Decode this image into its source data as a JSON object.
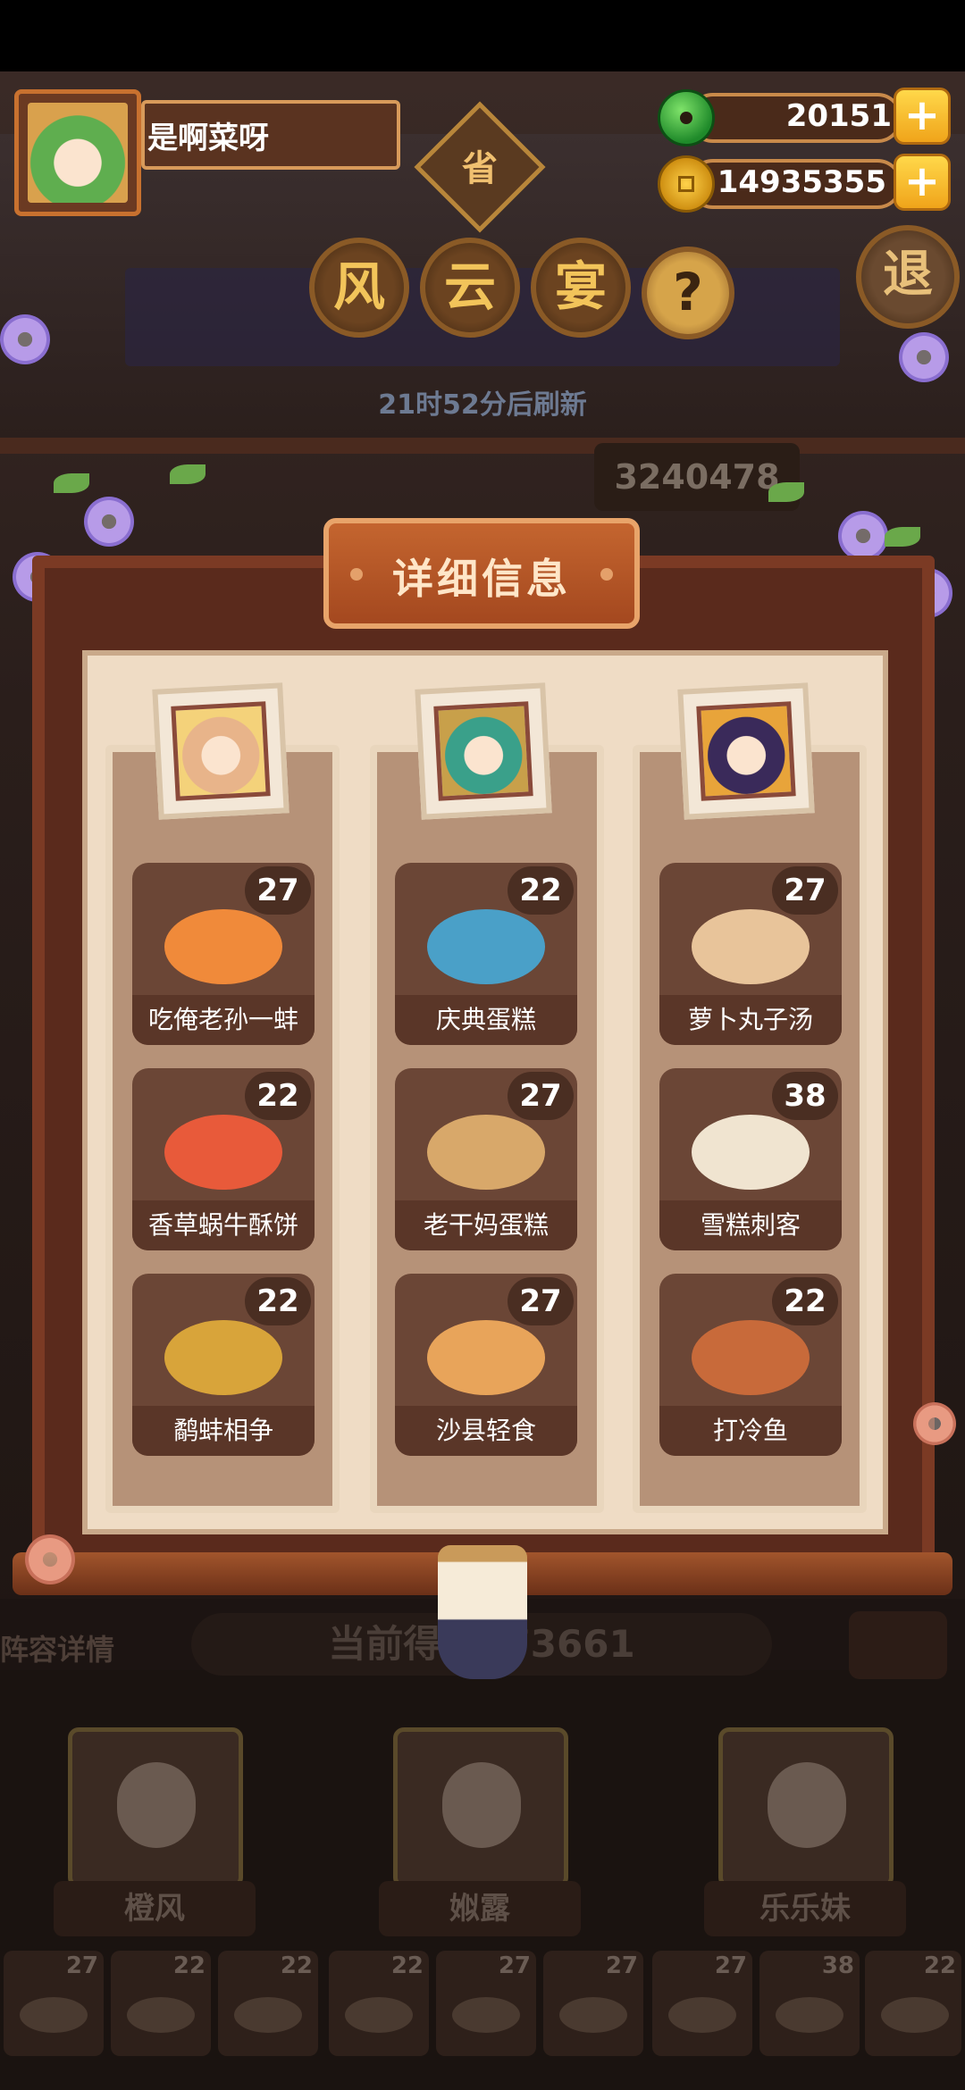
{
  "profile": {
    "name": "是啊菜呀"
  },
  "currency": {
    "jade": "20151",
    "coins": "14935355",
    "plus_label": "+"
  },
  "header": {
    "province_badge": "省",
    "title_chars": [
      "风",
      "云",
      "宴"
    ],
    "help_label": "?",
    "exit_label": "退",
    "refresh_text": "21时52分后刷新",
    "score_partial": "3240478"
  },
  "panel": {
    "title": "详细信息",
    "columns": [
      {
        "hero": "橙风",
        "dishes": [
          {
            "name": "吃俺老孙一蚌",
            "level": "27",
            "color": "#f08a3a"
          },
          {
            "name": "香草蜗牛酥饼",
            "level": "22",
            "color": "#e85a3a"
          },
          {
            "name": "鹬蚌相争",
            "level": "22",
            "color": "#d8a43a"
          }
        ]
      },
      {
        "hero": "娰露",
        "dishes": [
          {
            "name": "庆典蛋糕",
            "level": "22",
            "color": "#4aa0c8"
          },
          {
            "name": "老干妈蛋糕",
            "level": "27",
            "color": "#d8a86a"
          },
          {
            "name": "沙县轻食",
            "level": "27",
            "color": "#e8a45a"
          }
        ]
      },
      {
        "hero": "乐乐妹",
        "dishes": [
          {
            "name": "萝卜丸子汤",
            "level": "27",
            "color": "#e8c49a"
          },
          {
            "name": "雪糕刺客",
            "level": "38",
            "color": "#f0e4d0"
          },
          {
            "name": "打冷鱼",
            "level": "22",
            "color": "#c86a3a"
          }
        ]
      }
    ]
  },
  "bottom": {
    "lineup_label": "阵容详情",
    "current_score": "当前得分773661",
    "characters": [
      {
        "name": "橙风"
      },
      {
        "name": "娰露"
      },
      {
        "name": "乐乐妹"
      }
    ],
    "mini_dishes": [
      "27",
      "22",
      "22",
      "22",
      "27",
      "27",
      "27",
      "38",
      "22"
    ]
  }
}
